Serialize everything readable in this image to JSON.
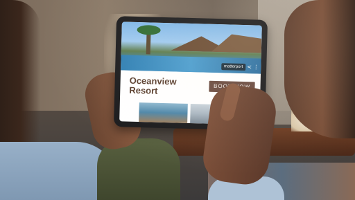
{
  "photo": {
    "resort_title": "Oceanview Resort",
    "book_button": "BOOK NOW",
    "badge_text": "matterport",
    "share_glyph": "<",
    "more_glyph": "⋮"
  },
  "colors": {
    "title_brown": "#5a3e2e",
    "button_bg": "#6a4b40",
    "button_text": "#f4ece6"
  }
}
